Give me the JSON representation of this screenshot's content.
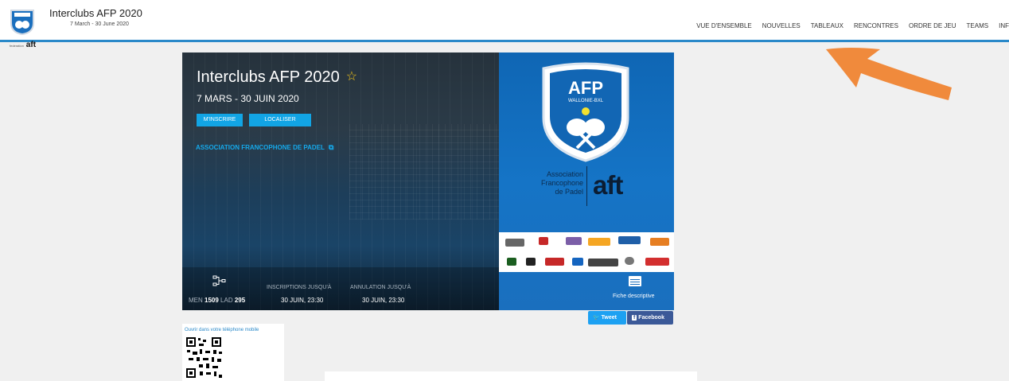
{
  "header": {
    "title": "Interclubs AFP 2020",
    "dates": "7 March - 30 June 2020",
    "brand_mini": "aft",
    "nav": [
      "VUE D'ENSEMBLE",
      "NOUVELLES",
      "TABLEAUX",
      "RENCONTRES",
      "ORDRE DE JEU",
      "TEAMS",
      "INF"
    ]
  },
  "hero": {
    "title": "Interclubs AFP 2020",
    "dates": "7 MARS - 30 JUIN 2020",
    "btn_inscrire": "M'INSCRIRE",
    "btn_localiser": "LOCALISER",
    "org_link": "ASSOCIATION FRANCOPHONE DE PADEL",
    "stats": {
      "men_label": "MEN",
      "men_value": "1509",
      "lad_label": "LAD",
      "lad_value": "295",
      "inscriptions_label": "INSCRIPTIONS JUSQU'À",
      "inscriptions_value": "30 JUIN, 23:30",
      "annulation_label": "ANNULATION JUSQU'À",
      "annulation_value": "30 JUIN, 23:30"
    },
    "badge_title": "AFP",
    "badge_subtitle": "WALLONIE-BXL",
    "assoc_line1": "Association",
    "assoc_line2": "Francophone",
    "assoc_line3": "de Padel",
    "aft_mark": "aft",
    "fiche_label": "Fiche descriptive"
  },
  "share": {
    "tweet": "Tweet",
    "facebook": "Facebook"
  },
  "mobile": {
    "text": "Ouvrir dans votre téléphone mobile"
  },
  "colors": {
    "accent": "#2a89c9",
    "button": "#12a5e5",
    "star": "#f5c518",
    "arrow": "#f08a3c"
  }
}
